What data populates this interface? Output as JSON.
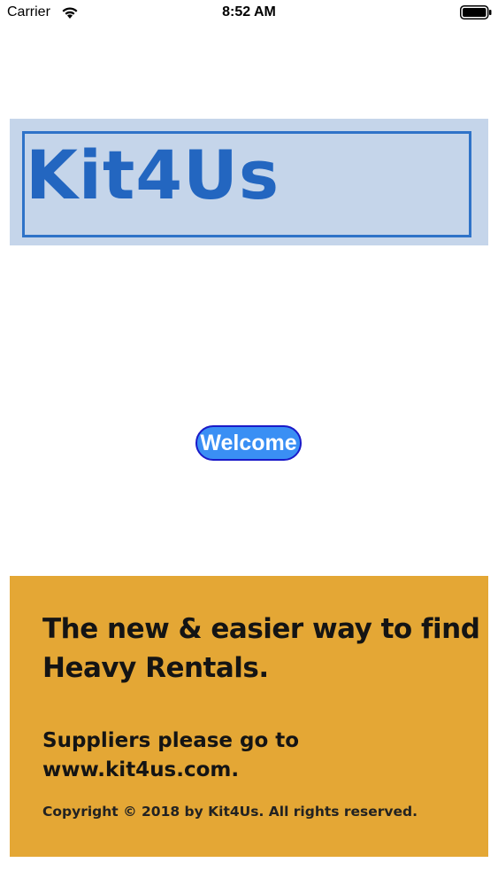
{
  "status_bar": {
    "carrier": "Carrier",
    "time": "8:52 AM",
    "wifi_icon": "wifi-icon",
    "battery_icon": "battery-icon"
  },
  "logo": {
    "text": "Kit4Us",
    "colors": {
      "background": "#c5d5ea",
      "border": "#2f73c8",
      "text": "#2366c0"
    }
  },
  "welcome_button": {
    "label": "Welcome",
    "colors": {
      "fill": "#3a8ff4",
      "border": "#1a1ac9",
      "text": "#ffffff"
    }
  },
  "promo": {
    "headline_line1": "The new & easier way to find",
    "headline_line2": "Heavy Rentals.",
    "suppliers_line1": "Suppliers please go to",
    "suppliers_line2": "www.kit4us.com.",
    "copyright": "Copyright  © 2018 by Kit4Us. All rights reserved.",
    "background_color": "#e4a735"
  }
}
